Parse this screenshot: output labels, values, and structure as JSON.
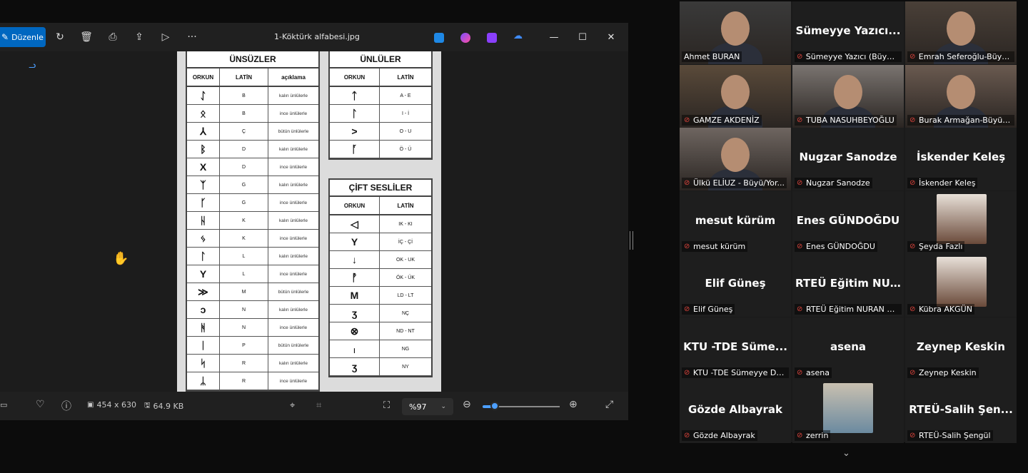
{
  "viewer": {
    "edit_label": "Düzenle",
    "file_name": "1-Köktürk alfabesi.jpg",
    "icons": [
      "rotate-icon",
      "delete-icon",
      "print-icon",
      "share-icon",
      "slideshow-icon",
      "more-icon"
    ],
    "image_dimensions": "454 x 630",
    "file_size": "64.9 KB",
    "zoom": "%97",
    "zoom_fraction": 0.16
  },
  "doc": {
    "consonants": {
      "title": "ÜNSÜZLER",
      "cols": [
        "ORKUN",
        "LATİN",
        "açıklama"
      ],
      "rows": [
        [
          "ᛇ",
          "B",
          "kalın ünlülerle"
        ],
        [
          "ᛟ",
          "B",
          "ince ünlülerle"
        ],
        [
          "⅄",
          "Ç",
          "bütün ünlülerle"
        ],
        [
          "ᛒ",
          "D",
          "kalın ünlülerle"
        ],
        [
          "X",
          "D",
          "ince ünlülerle"
        ],
        [
          "ᛉ",
          "G",
          "kalın ünlülerle"
        ],
        [
          "ᚴ",
          "G",
          "ince ünlülerle"
        ],
        [
          "ᚺ",
          "K",
          "kalın ünlülerle"
        ],
        [
          "ᛃ",
          "K",
          "ince ünlülerle"
        ],
        [
          "ᛚ",
          "L",
          "kalın ünlülerle"
        ],
        [
          "Y",
          "L",
          "ince ünlülerle"
        ],
        [
          "≫",
          "M",
          "bütün ünlülerle"
        ],
        [
          "ↄ",
          "N",
          "kalın ünlülerle"
        ],
        [
          "ᚻ",
          "N",
          "ince ünlülerle"
        ],
        [
          "ᛁ",
          "P",
          "bütün ünlülerle"
        ],
        [
          "ᛋ",
          "R",
          "kalın ünlülerle"
        ],
        [
          "ᛦ",
          "R",
          "ince ünlülerle"
        ]
      ]
    },
    "vowels": {
      "title": "ÜNLÜLER",
      "cols": [
        "ORKUN",
        "LATİN"
      ],
      "rows": [
        [
          "ᛏ",
          "A - E"
        ],
        [
          "ᛚ",
          "I - İ"
        ],
        [
          ">",
          "O - U"
        ],
        [
          "ᚪ",
          "Ö - Ü"
        ]
      ]
    },
    "double": {
      "title": "ÇİFT SESLİLER",
      "cols": [
        "ORKUN",
        "LATİN"
      ],
      "rows": [
        [
          "◁",
          "IK - KI"
        ],
        [
          "Y",
          "İÇ - Çİ"
        ],
        [
          "↓",
          "OK - UK"
        ],
        [
          "ᚡ",
          "ÖK - ÜK"
        ],
        [
          "M",
          "LD - LT"
        ],
        [
          "ʒ",
          "NÇ"
        ],
        [
          "⊗",
          "ND - NT"
        ],
        [
          "ᛧ",
          "NG"
        ],
        [
          "ʒ",
          "NY"
        ]
      ]
    }
  },
  "participants": [
    {
      "big": "",
      "label": "Ahmet BURAN",
      "muted": false,
      "video": true,
      "active": true
    },
    {
      "big": "Sümeyye  Yazıcı...",
      "label": "Sümeyye Yazıcı (Büyü/...",
      "muted": true,
      "video": false
    },
    {
      "big": "",
      "label": "Emrah Seferoğlu-Büyü...",
      "muted": true,
      "video": true
    },
    {
      "big": "",
      "label": "GAMZE AKDENİZ",
      "muted": true,
      "video": true
    },
    {
      "big": "",
      "label": "TUBA NASUHBEYOĞLU",
      "muted": true,
      "video": true
    },
    {
      "big": "",
      "label": "Burak Armağan-Büyü/...",
      "muted": true,
      "video": true
    },
    {
      "big": "",
      "label": "Ülkü ELİUZ - Büyü/Yor...",
      "muted": true,
      "video": true
    },
    {
      "big": "Nugzar Sanodze",
      "label": "Nugzar Sanodze",
      "muted": true,
      "video": false
    },
    {
      "big": "İskender Keleş",
      "label": "İskender Keleş",
      "muted": true,
      "video": false
    },
    {
      "big": "mesut kürüm",
      "label": "mesut kürüm",
      "muted": true,
      "video": false
    },
    {
      "big": "Enes GÜNDOĞDU",
      "label": "Enes GÜNDOĞDU",
      "muted": true,
      "video": false
    },
    {
      "big": "",
      "label": "Şeyda Fazlı",
      "muted": true,
      "video": false,
      "avatar": true
    },
    {
      "big": "Elif Güneş",
      "label": "Elif Güneş",
      "muted": true,
      "video": false
    },
    {
      "big": "RTEÜ  Eğitim  NU...",
      "label": "RTEÜ Eğitim NURAN A...",
      "muted": true,
      "video": false
    },
    {
      "big": "",
      "label": "Kübra AKGÜN",
      "muted": true,
      "video": false,
      "avatar": true
    },
    {
      "big": "KTU  -TDE  Süme...",
      "label": "KTU -TDE Sümeyye D*...",
      "muted": true,
      "video": false
    },
    {
      "big": "asena",
      "label": "asena",
      "muted": true,
      "video": false
    },
    {
      "big": "Zeynep Keskin",
      "label": "Zeynep Keskin",
      "muted": true,
      "video": false
    },
    {
      "big": "Gözde Albayrak",
      "label": "Gözde Albayrak",
      "muted": true,
      "video": false
    },
    {
      "big": "",
      "label": "zerrin",
      "muted": true,
      "video": false,
      "avatar": true
    },
    {
      "big": "RTEÜ-Salih  Şen...",
      "label": "RTEÜ-Salih Şengül",
      "muted": true,
      "video": false
    }
  ]
}
